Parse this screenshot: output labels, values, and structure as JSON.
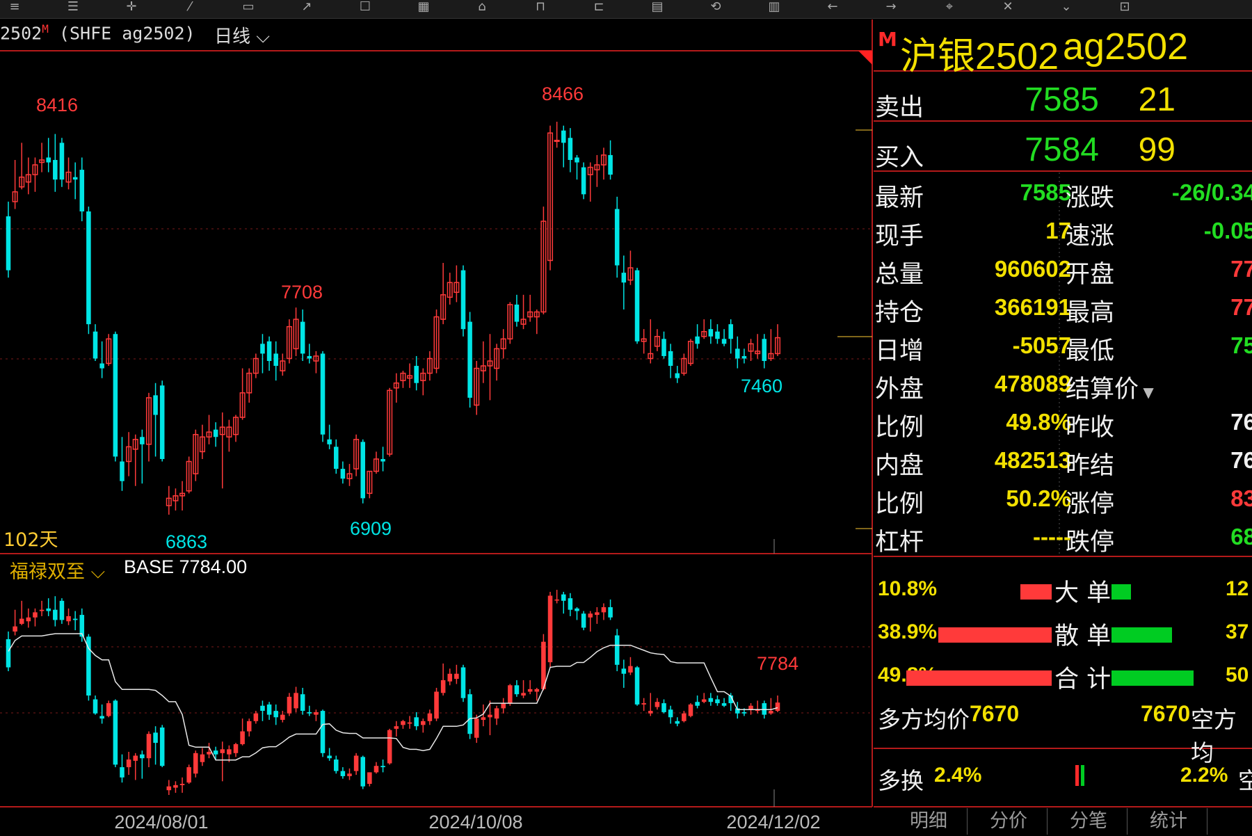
{
  "toolbar": {
    "icons": [
      "menu-icon",
      "list-icon",
      "crosshair-icon",
      "draw-icon",
      "window-icon",
      "arrow-icon",
      "bell-icon",
      "grid-icon",
      "box-icon",
      "chart-icon",
      "ruler-icon",
      "calendar-icon",
      "cycle-icon",
      "chart2-icon",
      "back-icon",
      "forward-icon",
      "cursor-icon",
      "close-icon",
      "chevron-icon",
      "lock-icon"
    ]
  },
  "chart": {
    "contract": "2502",
    "contract_mark": "M",
    "exchange_code": "(SHFE ag2502)",
    "period": "日线",
    "days_label": "102天",
    "indicator_name": "福禄双至",
    "base_label": "BASE 7784.00",
    "peak_labels": [
      "8416",
      "7708",
      "8466"
    ],
    "trough_labels": [
      "6863",
      "6909",
      "7460"
    ],
    "last_label": "7784",
    "x_labels": [
      "2024/08/01",
      "2024/10/08",
      "2024/12/02"
    ]
  },
  "chart_data": {
    "type": "candlestick",
    "title": "2502 (SHFE ag2502) 日线",
    "x_labels": [
      "2024/08/01",
      "2024/10/08",
      "2024/12/02"
    ],
    "annotated_highs": [
      8416,
      7708,
      8466
    ],
    "annotated_lows": [
      6863,
      6909,
      7460
    ],
    "indicator": {
      "name": "福禄双至",
      "base": 7784.0,
      "last": 7784
    },
    "up_color": "#ff3a3a",
    "down_color": "#00e5e5",
    "candles": [
      {
        "o": 8080,
        "h": 8140,
        "l": 7830,
        "c": 7860
      },
      {
        "o": 8140,
        "h": 8310,
        "l": 8110,
        "c": 8180
      },
      {
        "o": 8200,
        "h": 8380,
        "l": 8190,
        "c": 8240
      },
      {
        "o": 8220,
        "h": 8320,
        "l": 8170,
        "c": 8250
      },
      {
        "o": 8250,
        "h": 8320,
        "l": 8180,
        "c": 8290
      },
      {
        "o": 8300,
        "h": 8380,
        "l": 8260,
        "c": 8310
      },
      {
        "o": 8320,
        "h": 8400,
        "l": 8260,
        "c": 8300
      },
      {
        "o": 8310,
        "h": 8416,
        "l": 8180,
        "c": 8230
      },
      {
        "o": 8380,
        "h": 8400,
        "l": 8200,
        "c": 8230
      },
      {
        "o": 8220,
        "h": 8320,
        "l": 8190,
        "c": 8260
      },
      {
        "o": 8240,
        "h": 8300,
        "l": 8150,
        "c": 8230
      },
      {
        "o": 8270,
        "h": 8320,
        "l": 8060,
        "c": 8100
      },
      {
        "o": 8100,
        "h": 8120,
        "l": 7600,
        "c": 7640
      },
      {
        "o": 7610,
        "h": 7640,
        "l": 7490,
        "c": 7500
      },
      {
        "o": 7480,
        "h": 7570,
        "l": 7420,
        "c": 7460
      },
      {
        "o": 7480,
        "h": 7600,
        "l": 7470,
        "c": 7580
      },
      {
        "o": 7600,
        "h": 7610,
        "l": 7080,
        "c": 7100
      },
      {
        "o": 7080,
        "h": 7180,
        "l": 6960,
        "c": 7000
      },
      {
        "o": 7080,
        "h": 7200,
        "l": 7020,
        "c": 7140
      },
      {
        "o": 7130,
        "h": 7190,
        "l": 6980,
        "c": 7170
      },
      {
        "o": 7180,
        "h": 7210,
        "l": 6990,
        "c": 7150
      },
      {
        "o": 7150,
        "h": 7360,
        "l": 7080,
        "c": 7340
      },
      {
        "o": 7350,
        "h": 7400,
        "l": 7100,
        "c": 7270
      },
      {
        "o": 7390,
        "h": 7410,
        "l": 7080,
        "c": 7090
      },
      {
        "o": 6900,
        "h": 6980,
        "l": 6863,
        "c": 6930
      },
      {
        "o": 6920,
        "h": 6970,
        "l": 6880,
        "c": 6940
      },
      {
        "o": 6940,
        "h": 7000,
        "l": 6880,
        "c": 6950
      },
      {
        "o": 6960,
        "h": 7100,
        "l": 6950,
        "c": 7080
      },
      {
        "o": 7030,
        "h": 7210,
        "l": 7000,
        "c": 7190
      },
      {
        "o": 7120,
        "h": 7230,
        "l": 7090,
        "c": 7180
      },
      {
        "o": 7180,
        "h": 7270,
        "l": 7150,
        "c": 7200
      },
      {
        "o": 7210,
        "h": 7240,
        "l": 7140,
        "c": 7180
      },
      {
        "o": 7190,
        "h": 7280,
        "l": 6970,
        "c": 7220
      },
      {
        "o": 7180,
        "h": 7250,
        "l": 7120,
        "c": 7220
      },
      {
        "o": 7190,
        "h": 7270,
        "l": 7160,
        "c": 7260
      },
      {
        "o": 7260,
        "h": 7460,
        "l": 7250,
        "c": 7360
      },
      {
        "o": 7360,
        "h": 7460,
        "l": 7320,
        "c": 7440
      },
      {
        "o": 7440,
        "h": 7520,
        "l": 7420,
        "c": 7500
      },
      {
        "o": 7560,
        "h": 7600,
        "l": 7440,
        "c": 7520
      },
      {
        "o": 7570,
        "h": 7590,
        "l": 7450,
        "c": 7490
      },
      {
        "o": 7520,
        "h": 7570,
        "l": 7410,
        "c": 7470
      },
      {
        "o": 7450,
        "h": 7520,
        "l": 7430,
        "c": 7490
      },
      {
        "o": 7500,
        "h": 7660,
        "l": 7480,
        "c": 7630
      },
      {
        "o": 7540,
        "h": 7708,
        "l": 7510,
        "c": 7660
      },
      {
        "o": 7650,
        "h": 7700,
        "l": 7490,
        "c": 7520
      },
      {
        "o": 7510,
        "h": 7560,
        "l": 7480,
        "c": 7500
      },
      {
        "o": 7490,
        "h": 7530,
        "l": 7440,
        "c": 7510
      },
      {
        "o": 7520,
        "h": 7530,
        "l": 7160,
        "c": 7190
      },
      {
        "o": 7170,
        "h": 7230,
        "l": 7130,
        "c": 7150
      },
      {
        "o": 7140,
        "h": 7170,
        "l": 7030,
        "c": 7050
      },
      {
        "o": 7050,
        "h": 7080,
        "l": 6990,
        "c": 7010
      },
      {
        "o": 7010,
        "h": 7070,
        "l": 6980,
        "c": 7030
      },
      {
        "o": 7050,
        "h": 7190,
        "l": 7020,
        "c": 7170
      },
      {
        "o": 7160,
        "h": 7170,
        "l": 6909,
        "c": 6930
      },
      {
        "o": 6950,
        "h": 7040,
        "l": 6930,
        "c": 7040
      },
      {
        "o": 7040,
        "h": 7120,
        "l": 7030,
        "c": 7090
      },
      {
        "o": 7090,
        "h": 7140,
        "l": 7040,
        "c": 7080
      },
      {
        "o": 7110,
        "h": 7380,
        "l": 7100,
        "c": 7370
      },
      {
        "o": 7380,
        "h": 7440,
        "l": 7320,
        "c": 7400
      },
      {
        "o": 7410,
        "h": 7450,
        "l": 7380,
        "c": 7440
      },
      {
        "o": 7420,
        "h": 7480,
        "l": 7380,
        "c": 7430
      },
      {
        "o": 7470,
        "h": 7510,
        "l": 7370,
        "c": 7400
      },
      {
        "o": 7410,
        "h": 7460,
        "l": 7350,
        "c": 7440
      },
      {
        "o": 7440,
        "h": 7530,
        "l": 7410,
        "c": 7500
      },
      {
        "o": 7460,
        "h": 7700,
        "l": 7440,
        "c": 7670
      },
      {
        "o": 7660,
        "h": 7890,
        "l": 7640,
        "c": 7760
      },
      {
        "o": 7750,
        "h": 7850,
        "l": 7720,
        "c": 7810
      },
      {
        "o": 7770,
        "h": 7880,
        "l": 7730,
        "c": 7810
      },
      {
        "o": 7860,
        "h": 7880,
        "l": 7590,
        "c": 7620
      },
      {
        "o": 7650,
        "h": 7690,
        "l": 7300,
        "c": 7340
      },
      {
        "o": 7310,
        "h": 7490,
        "l": 7270,
        "c": 7460
      },
      {
        "o": 7450,
        "h": 7570,
        "l": 7400,
        "c": 7470
      },
      {
        "o": 7470,
        "h": 7600,
        "l": 7330,
        "c": 7490
      },
      {
        "o": 7460,
        "h": 7560,
        "l": 7410,
        "c": 7540
      },
      {
        "o": 7540,
        "h": 7620,
        "l": 7500,
        "c": 7580
      },
      {
        "o": 7580,
        "h": 7730,
        "l": 7560,
        "c": 7720
      },
      {
        "o": 7720,
        "h": 7760,
        "l": 7630,
        "c": 7650
      },
      {
        "o": 7640,
        "h": 7760,
        "l": 7620,
        "c": 7660
      },
      {
        "o": 7670,
        "h": 7760,
        "l": 7650,
        "c": 7690
      },
      {
        "o": 7670,
        "h": 7700,
        "l": 7600,
        "c": 7690
      },
      {
        "o": 7690,
        "h": 8120,
        "l": 7680,
        "c": 8060
      },
      {
        "o": 7900,
        "h": 8450,
        "l": 7860,
        "c": 8420
      },
      {
        "o": 8390,
        "h": 8466,
        "l": 8360,
        "c": 8390
      },
      {
        "o": 8430,
        "h": 8450,
        "l": 8280,
        "c": 8380
      },
      {
        "o": 8400,
        "h": 8440,
        "l": 8260,
        "c": 8310
      },
      {
        "o": 8320,
        "h": 8330,
        "l": 8230,
        "c": 8300
      },
      {
        "o": 8280,
        "h": 8300,
        "l": 8150,
        "c": 8170
      },
      {
        "o": 8250,
        "h": 8300,
        "l": 8140,
        "c": 8280
      },
      {
        "o": 8270,
        "h": 8330,
        "l": 8200,
        "c": 8290
      },
      {
        "o": 8290,
        "h": 8360,
        "l": 8230,
        "c": 8330
      },
      {
        "o": 8330,
        "h": 8390,
        "l": 8230,
        "c": 8250
      },
      {
        "o": 8110,
        "h": 8160,
        "l": 7830,
        "c": 7880
      },
      {
        "o": 7850,
        "h": 7920,
        "l": 7700,
        "c": 7810
      },
      {
        "o": 7820,
        "h": 7940,
        "l": 7800,
        "c": 7870
      },
      {
        "o": 7860,
        "h": 7870,
        "l": 7560,
        "c": 7570
      },
      {
        "o": 7570,
        "h": 7620,
        "l": 7520,
        "c": 7580
      },
      {
        "o": 7500,
        "h": 7660,
        "l": 7480,
        "c": 7520
      },
      {
        "o": 7550,
        "h": 7620,
        "l": 7530,
        "c": 7590
      },
      {
        "o": 7580,
        "h": 7610,
        "l": 7500,
        "c": 7510
      },
      {
        "o": 7530,
        "h": 7560,
        "l": 7420,
        "c": 7470
      },
      {
        "o": 7440,
        "h": 7470,
        "l": 7400,
        "c": 7420
      },
      {
        "o": 7440,
        "h": 7520,
        "l": 7430,
        "c": 7500
      },
      {
        "o": 7480,
        "h": 7580,
        "l": 7470,
        "c": 7570
      },
      {
        "o": 7590,
        "h": 7640,
        "l": 7540,
        "c": 7560
      },
      {
        "o": 7590,
        "h": 7660,
        "l": 7580,
        "c": 7610
      },
      {
        "o": 7620,
        "h": 7660,
        "l": 7560,
        "c": 7590
      },
      {
        "o": 7610,
        "h": 7640,
        "l": 7560,
        "c": 7580
      },
      {
        "o": 7580,
        "h": 7620,
        "l": 7550,
        "c": 7560
      },
      {
        "o": 7640,
        "h": 7660,
        "l": 7520,
        "c": 7580
      },
      {
        "o": 7540,
        "h": 7590,
        "l": 7460,
        "c": 7500
      },
      {
        "o": 7510,
        "h": 7540,
        "l": 7480,
        "c": 7500
      },
      {
        "o": 7530,
        "h": 7580,
        "l": 7490,
        "c": 7560
      },
      {
        "o": 7520,
        "h": 7600,
        "l": 7500,
        "c": 7530
      },
      {
        "o": 7580,
        "h": 7600,
        "l": 7460,
        "c": 7490
      },
      {
        "o": 7500,
        "h": 7620,
        "l": 7490,
        "c": 7520
      },
      {
        "o": 7520,
        "h": 7640,
        "l": 7510,
        "c": 7585
      }
    ]
  },
  "quote": {
    "mark": "M",
    "name": "沪银2502",
    "code": "ag2502",
    "sell_label": "卖出",
    "sell_price": "7585",
    "sell_vol": "21",
    "buy_label": "买入",
    "buy_price": "7584",
    "buy_vol": "99",
    "rows": [
      {
        "l1": "最新",
        "v1": "7585",
        "l2": "涨跌",
        "v2": "-26/0.34"
      },
      {
        "l1": "现手",
        "v1": "17",
        "l2": "速涨",
        "v2": "-0.05"
      },
      {
        "l1": "总量",
        "v1": "960602",
        "l2": "开盘",
        "v2": "77"
      },
      {
        "l1": "持仓",
        "v1": "366191",
        "l2": "最高",
        "v2": "77"
      },
      {
        "l1": "日增",
        "v1": "-5057",
        "l2": "最低",
        "v2": "75"
      },
      {
        "l1": "外盘",
        "v1": "478089",
        "l2": "结算价",
        "v2": ""
      },
      {
        "l1": "比例",
        "v1": "49.8%",
        "l2": "昨收",
        "v2": "76"
      },
      {
        "l1": "内盘",
        "v1": "482513",
        "l2": "昨结",
        "v2": "76"
      },
      {
        "l1": "比例",
        "v1": "50.2%",
        "l2": "涨停",
        "v2": "83"
      },
      {
        "l1": "杠杆",
        "v1": "-----",
        "l2": "跌停",
        "v2": "68"
      }
    ],
    "flow": [
      {
        "left": "10.8%",
        "label": "大 单",
        "right": "12",
        "red": 0.108,
        "green": 0.12
      },
      {
        "left": "38.9%",
        "label": "散 单",
        "right": "37",
        "red": 0.389,
        "green": 0.37
      },
      {
        "left": "49.8%",
        "label": "合 计",
        "right": "50",
        "red": 0.498,
        "green": 0.5
      }
    ],
    "avg_long_label": "多方均价",
    "avg_long_value": "7670",
    "avg_short_value": "7670",
    "avg_short_label": "空方均",
    "exchange_long_label": "多换",
    "exchange_long_value": "2.4%",
    "exchange_short_value": "2.2%",
    "exchange_short_label": "空"
  },
  "tabs": [
    "明细",
    "分价",
    "分笔",
    "统计"
  ]
}
